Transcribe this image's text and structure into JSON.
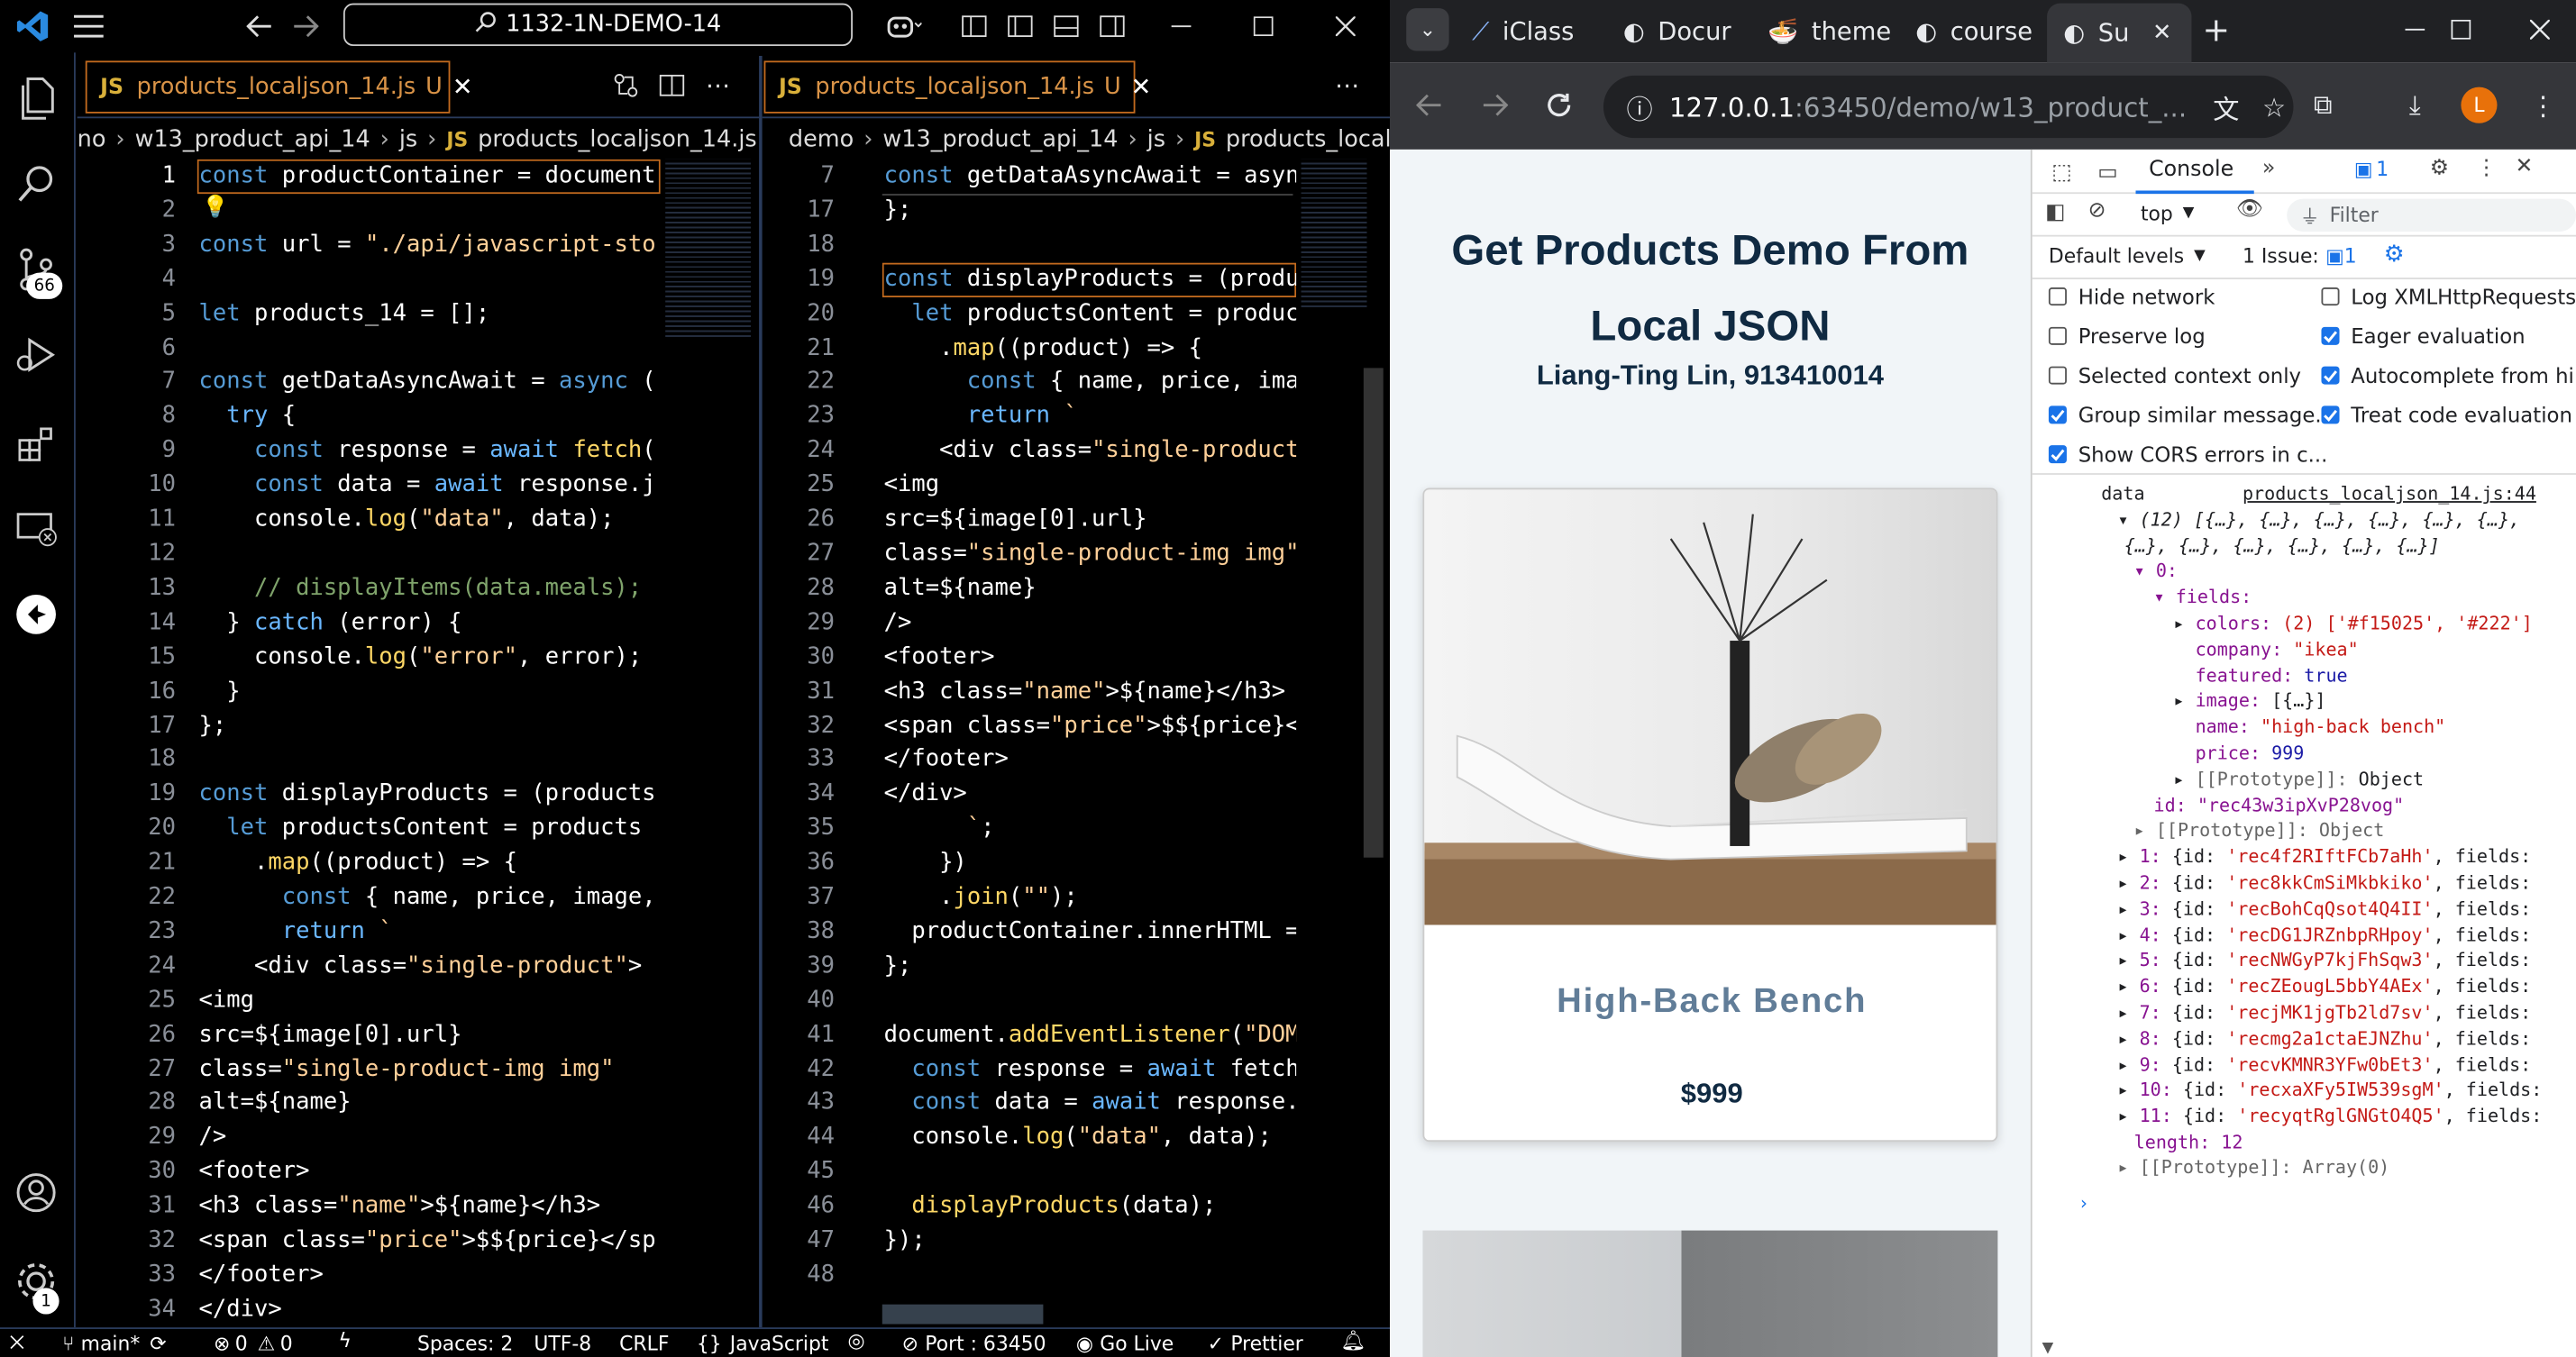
{
  "vscode": {
    "search_box": "1132-1N-DEMO-14",
    "activity_badges": {
      "source_control": "66",
      "account": "1"
    },
    "left": {
      "tab_label": "products_localjson_14.js",
      "tab_badge": "U",
      "breadcrumb": [
        "no",
        "w13_product_api_14",
        "js",
        "products_localjson_14.js",
        "..."
      ],
      "lines": [
        {
          "n": "1",
          "t": "const productContainer = document"
        },
        {
          "n": "2",
          "t": ""
        },
        {
          "n": "3",
          "t": "const url = \"./api/javascript-sto"
        },
        {
          "n": "4",
          "t": ""
        },
        {
          "n": "5",
          "t": "let products_14 = [];"
        },
        {
          "n": "6",
          "t": ""
        },
        {
          "n": "7",
          "t": "const getDataAsyncAwait = async ("
        },
        {
          "n": "8",
          "t": "  try {"
        },
        {
          "n": "9",
          "t": "    const response = await fetch("
        },
        {
          "n": "10",
          "t": "    const data = await response.j"
        },
        {
          "n": "11",
          "t": "    console.log(\"data\", data);"
        },
        {
          "n": "12",
          "t": ""
        },
        {
          "n": "13",
          "t": "    // displayItems(data.meals);"
        },
        {
          "n": "14",
          "t": "  } catch (error) {"
        },
        {
          "n": "15",
          "t": "    console.log(\"error\", error);"
        },
        {
          "n": "16",
          "t": "  }"
        },
        {
          "n": "17",
          "t": "};"
        },
        {
          "n": "18",
          "t": ""
        },
        {
          "n": "19",
          "t": "const displayProducts = (products"
        },
        {
          "n": "20",
          "t": "  let productsContent = products"
        },
        {
          "n": "21",
          "t": "    .map((product) => {"
        },
        {
          "n": "22",
          "t": "      const { name, price, image,"
        },
        {
          "n": "23",
          "t": "      return `"
        },
        {
          "n": "24",
          "t": "    <div class=\"single-product\">"
        },
        {
          "n": "25",
          "t": "<img"
        },
        {
          "n": "26",
          "t": "src=${image[0].url}"
        },
        {
          "n": "27",
          "t": "class=\"single-product-img img\""
        },
        {
          "n": "28",
          "t": "alt=${name}"
        },
        {
          "n": "29",
          "t": "/>"
        },
        {
          "n": "30",
          "t": "<footer>"
        },
        {
          "n": "31",
          "t": "<h3 class=\"name\">${name}</h3>"
        },
        {
          "n": "32",
          "t": "<span class=\"price\">$${price}</sp"
        },
        {
          "n": "33",
          "t": "</footer>"
        },
        {
          "n": "34",
          "t": "</div>"
        }
      ]
    },
    "right": {
      "tab_label": "products_localjson_14.js",
      "tab_badge": "U",
      "breadcrumb": [
        "demo",
        "w13_product_api_14",
        "js",
        "products_localjsor"
      ],
      "lines": [
        {
          "n": "7",
          "t": "const getDataAsyncAwait = asyn"
        },
        {
          "n": "17",
          "t": "};"
        },
        {
          "n": "18",
          "t": ""
        },
        {
          "n": "19",
          "t": "const displayProducts = (produ"
        },
        {
          "n": "20",
          "t": "  let productsContent = produc"
        },
        {
          "n": "21",
          "t": "    .map((product) => {"
        },
        {
          "n": "22",
          "t": "      const { name, price, ima"
        },
        {
          "n": "23",
          "t": "      return `"
        },
        {
          "n": "24",
          "t": "    <div class=\"single-product"
        },
        {
          "n": "25",
          "t": "<img"
        },
        {
          "n": "26",
          "t": "src=${image[0].url}"
        },
        {
          "n": "27",
          "t": "class=\"single-product-img img\""
        },
        {
          "n": "28",
          "t": "alt=${name}"
        },
        {
          "n": "29",
          "t": "/>"
        },
        {
          "n": "30",
          "t": "<footer>"
        },
        {
          "n": "31",
          "t": "<h3 class=\"name\">${name}</h3>"
        },
        {
          "n": "32",
          "t": "<span class=\"price\">$${price}<"
        },
        {
          "n": "33",
          "t": "</footer>"
        },
        {
          "n": "34",
          "t": "</div>"
        },
        {
          "n": "35",
          "t": "      `;"
        },
        {
          "n": "36",
          "t": "    })"
        },
        {
          "n": "37",
          "t": "    .join(\"\");"
        },
        {
          "n": "38",
          "t": "  productContainer.innerHTML ="
        },
        {
          "n": "39",
          "t": "};"
        },
        {
          "n": "40",
          "t": ""
        },
        {
          "n": "41",
          "t": "document.addEventListener(\"DOM"
        },
        {
          "n": "42",
          "t": "  const response = await fetch"
        },
        {
          "n": "43",
          "t": "  const data = await response."
        },
        {
          "n": "44",
          "t": "  console.log(\"data\", data);"
        },
        {
          "n": "45",
          "t": ""
        },
        {
          "n": "46",
          "t": "  displayProducts(data);"
        },
        {
          "n": "47",
          "t": "});"
        },
        {
          "n": "48",
          "t": ""
        }
      ]
    },
    "status": {
      "branch": "main*",
      "errors": "0",
      "warnings": "0",
      "spaces": "Spaces: 2",
      "encoding": "UTF-8",
      "eol": "CRLF",
      "language": "JavaScript",
      "port": "Port : 63450",
      "go_live": "Go Live",
      "prettier": "Prettier"
    }
  },
  "chrome": {
    "tabs": [
      "iClass",
      "Docur",
      "theme",
      "course",
      "Su"
    ],
    "url_host": "127.0.0.1",
    "url_rest": ":63450/demo/w13_product_...",
    "profile_initial": "L",
    "page": {
      "title": "Get Products Demo From Local JSON",
      "subtitle": "Liang-Ting Lin, 913410014",
      "product_name": "High-Back Bench",
      "product_price": "$999"
    },
    "devtools": {
      "tab_console": "Console",
      "issues_count": "1",
      "context": "top",
      "filter_placeholder": "Filter",
      "levels": "Default levels",
      "issue_text": "1 Issue:",
      "issue_num": "1",
      "settings": [
        {
          "label": "Hide network",
          "checked": false
        },
        {
          "label": "Log XMLHttpRequests",
          "checked": false
        },
        {
          "label": "Preserve log",
          "checked": false
        },
        {
          "label": "Eager evaluation",
          "checked": true
        },
        {
          "label": "Selected context only",
          "checked": false
        },
        {
          "label": "Autocomplete from hi...",
          "checked": true
        },
        {
          "label": "Group similar message...",
          "checked": true
        },
        {
          "label": "Treat code evaluation ...",
          "checked": true
        },
        {
          "label": "Show CORS errors in c...",
          "checked": true
        }
      ],
      "log_label": "data",
      "log_source": "products_localjson_14.js:44",
      "array_summary_1": "(12) [{…}, {…}, {…}, {…}, {…}, {…},",
      "array_summary_2": "{…}, {…}, {…}, {…}, {…}, {…}]",
      "item0_key": "0:",
      "fields_key": "fields:",
      "fields": [
        {
          "k": "colors:",
          "v": "(2) ['#f15025', '#222']"
        },
        {
          "k": "company:",
          "v": "\"ikea\""
        },
        {
          "k": "featured:",
          "v": "true"
        },
        {
          "k": "image:",
          "v": "[{…}]"
        },
        {
          "k": "name:",
          "v": "\"high-back bench\""
        },
        {
          "k": "price:",
          "v": "999"
        },
        {
          "k": "[[Prototype]]:",
          "v": "Object"
        }
      ],
      "id_line": "id: \"rec43w3ipXvP28vog\"",
      "proto_line": "[[Prototype]]: Object",
      "items": [
        "1: {id: 'rec4f2RIftFCb7aHh', fields:",
        "2: {id: 'rec8kkCmSiMkbkiko', fields:",
        "3: {id: 'recBohCqQsot4Q4II', fields:",
        "4: {id: 'recDG1JRZnbpRHpoy', fields:",
        "5: {id: 'recNWGyP7kjFhSqw3', fields:",
        "6: {id: 'recZEougL5bbY4AEx', fields:",
        "7: {id: 'recjMK1jgTb2ld7sv', fields:",
        "8: {id: 'recmg2a1ctaEJNZhu', fields:",
        "9: {id: 'recvKMNR3YFw0bEt3', fields:",
        "10: {id: 'recxaXFy5IW539sgM', fields:",
        "11: {id: 'recyqtRglGNGtO4Q5', fields:"
      ],
      "length_line": "length: 12",
      "array_proto": "[[Prototype]]: Array(0)"
    }
  }
}
